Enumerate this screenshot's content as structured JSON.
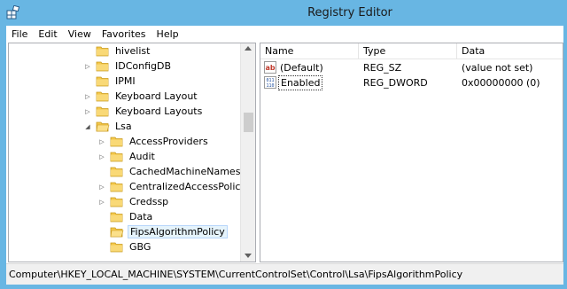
{
  "window": {
    "title": "Registry Editor",
    "titlebar_color": "#68b6e3"
  },
  "menu": {
    "items": [
      "File",
      "Edit",
      "View",
      "Favorites",
      "Help"
    ]
  },
  "tree": {
    "items": [
      {
        "label": "hivelist",
        "expander": "",
        "selected": false
      },
      {
        "label": "IDConfigDB",
        "expander": "▷",
        "selected": false
      },
      {
        "label": "IPMI",
        "expander": "",
        "selected": false
      },
      {
        "label": "Keyboard Layout",
        "expander": "▷",
        "selected": false
      },
      {
        "label": "Keyboard Layouts",
        "expander": "▷",
        "selected": false
      },
      {
        "label": "Lsa",
        "expander": "◢",
        "selected": false
      },
      {
        "label": "AccessProviders",
        "expander": "▷",
        "selected": false
      },
      {
        "label": "Audit",
        "expander": "▷",
        "selected": false
      },
      {
        "label": "CachedMachineNames",
        "expander": "",
        "selected": false
      },
      {
        "label": "CentralizedAccessPolicies",
        "expander": "▷",
        "selected": false
      },
      {
        "label": "Credssp",
        "expander": "▷",
        "selected": false
      },
      {
        "label": "Data",
        "expander": "",
        "selected": false
      },
      {
        "label": "FipsAlgorithmPolicy",
        "expander": "",
        "selected": true
      },
      {
        "label": "GBG",
        "expander": "",
        "selected": false
      }
    ]
  },
  "list": {
    "columns": [
      "Name",
      "Type",
      "Data"
    ],
    "rows": [
      {
        "name": "(Default)",
        "icon": "string-value-icon",
        "type": "REG_SZ",
        "data": "(value not set)"
      },
      {
        "name": "Enabled",
        "icon": "dword-value-icon",
        "type": "REG_DWORD",
        "data": "0x00000000 (0)"
      }
    ]
  },
  "statusbar": {
    "path": "Computer\\HKEY_LOCAL_MACHINE\\SYSTEM\\CurrentControlSet\\Control\\Lsa\\FipsAlgorithmPolicy"
  }
}
